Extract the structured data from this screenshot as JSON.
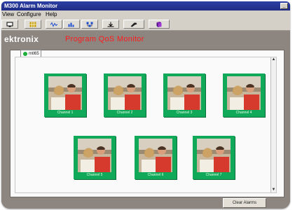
{
  "window": {
    "title": "M300  Alarm Monitor",
    "colors": {
      "frame": "#8c8580",
      "title_bar": "#2d3fa4",
      "tile": "#10a95a",
      "product_text": "#ff1b1b"
    }
  },
  "menu": {
    "items": [
      "View",
      "Configure",
      "Help"
    ]
  },
  "toolbar": {
    "icons": [
      "monitor-icon",
      "grid-icon",
      "waveform-icon",
      "bar-chart-icon",
      "network-icon",
      "download-icon",
      "tool-icon",
      "book-icon"
    ]
  },
  "header": {
    "brand": "ektronix",
    "product": "Program QoS Monitor"
  },
  "tab": {
    "label": "mtl65"
  },
  "programs": [
    {
      "caption": "Channel 1"
    },
    {
      "caption": "Channel 2"
    },
    {
      "caption": "Channel 3"
    },
    {
      "caption": "Channel 4"
    },
    {
      "caption": "Channel 5"
    },
    {
      "caption": "Channel 6"
    },
    {
      "caption": "Channel 7"
    }
  ],
  "footer": {
    "clear_alarms": "Clear Alarms"
  }
}
